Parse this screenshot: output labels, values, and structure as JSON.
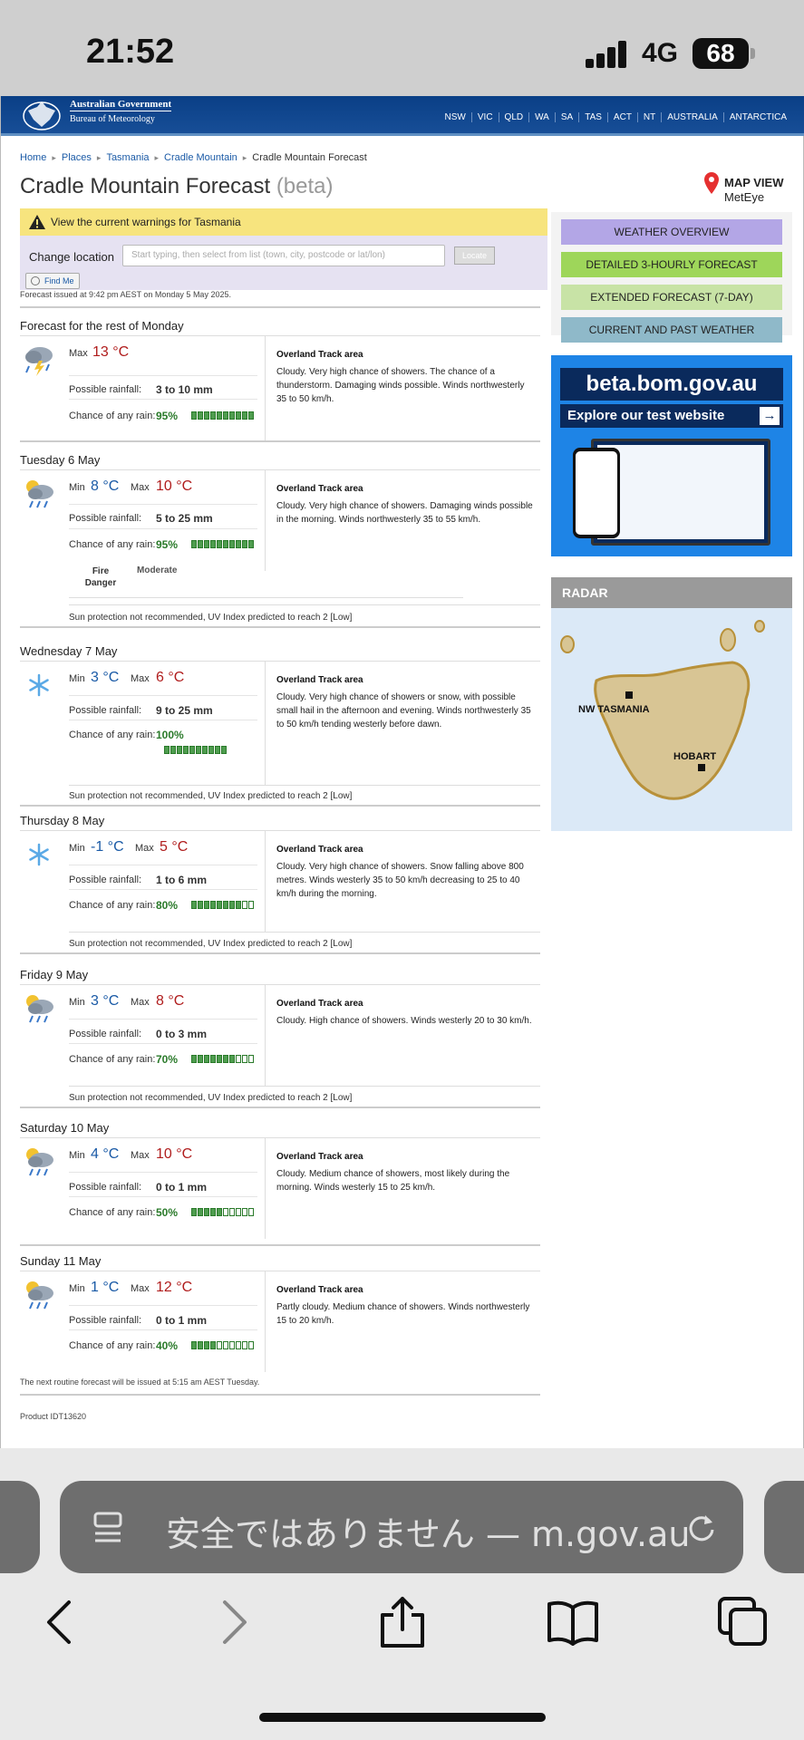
{
  "status_bar": {
    "time": "21:52",
    "network": "4G",
    "battery": "68"
  },
  "header": {
    "gov_line1": "Australian Government",
    "gov_line2": "Bureau of Meteorology",
    "nav": [
      "NSW",
      "VIC",
      "QLD",
      "WA",
      "SA",
      "TAS",
      "ACT",
      "NT",
      "AUSTRALIA",
      "ANTARCTICA"
    ]
  },
  "breadcrumbs": [
    "Home",
    "Places",
    "Tasmania",
    "Cradle Mountain",
    "Cradle Mountain Forecast"
  ],
  "page_title": {
    "main": "Cradle Mountain Forecast",
    "suffix": "(beta)"
  },
  "map_view": {
    "line1": "MAP VIEW",
    "line2": "MetEye"
  },
  "warning": {
    "text": "View the current warnings for Tasmania"
  },
  "location": {
    "label": "Change location",
    "placeholder": "Start typing, then select from list (town, city, postcode or lat/lon)",
    "locate_button": "Locate",
    "find_me": "Find Me"
  },
  "issued": "Forecast issued at 9:42 pm AEST on Monday 5 May 2025.",
  "labels": {
    "min": "Min",
    "max": "Max",
    "possible_rainfall": "Possible rainfall:",
    "chance_rain": "Chance of any rain:",
    "area": "Overland Track area"
  },
  "days": [
    {
      "name": "Forecast for the rest of Monday",
      "icon": "storm-icon",
      "max": "13 °C",
      "rainfall": "3 to 10 mm",
      "chance": "95%",
      "chance_fraction": 0.95,
      "desc": "Cloudy. Very high chance of showers. The chance of a thunderstorm. Damaging winds possible. Winds northwesterly 35 to 50 km/h."
    },
    {
      "name": "Tuesday 6 May",
      "icon": "showers-icon",
      "min": "8 °C",
      "max": "10 °C",
      "rainfall": "5 to 25 mm",
      "chance": "95%",
      "chance_fraction": 0.95,
      "desc": "Cloudy. Very high chance of showers. Damaging winds possible in the morning. Winds northwesterly 35 to 55 km/h.",
      "fire_label": "Fire Danger",
      "fire_value": "Moderate",
      "uv": "Sun protection not recommended, UV Index predicted to reach 2 [Low]"
    },
    {
      "name": "Wednesday 7 May",
      "icon": "snow-icon",
      "min": "3 °C",
      "max": "6 °C",
      "rainfall": "9 to 25 mm",
      "chance": "100%",
      "chance_fraction": 1.0,
      "desc": "Cloudy. Very high chance of showers or snow, with possible small hail in the afternoon and evening. Winds northwesterly 35 to 50 km/h tending westerly before dawn.",
      "uv": "Sun protection not recommended, UV Index predicted to reach 2 [Low]"
    },
    {
      "name": "Thursday 8 May",
      "icon": "snow-icon",
      "min": "-1 °C",
      "max": "5 °C",
      "rainfall": "1 to 6 mm",
      "chance": "80%",
      "chance_fraction": 0.8,
      "desc": "Cloudy. Very high chance of showers. Snow falling above 800 metres. Winds westerly 35 to 50 km/h decreasing to 25 to 40 km/h during the morning.",
      "uv": "Sun protection not recommended, UV Index predicted to reach 2 [Low]"
    },
    {
      "name": "Friday 9 May",
      "icon": "showers-icon",
      "min": "3 °C",
      "max": "8 °C",
      "rainfall": "0 to 3 mm",
      "chance": "70%",
      "chance_fraction": 0.7,
      "desc": "Cloudy. High chance of showers. Winds westerly 20 to 30 km/h.",
      "uv": "Sun protection not recommended, UV Index predicted to reach 2 [Low]"
    },
    {
      "name": "Saturday 10 May",
      "icon": "showers-icon",
      "min": "4 °C",
      "max": "10 °C",
      "rainfall": "0 to 1 mm",
      "chance": "50%",
      "chance_fraction": 0.5,
      "desc": "Cloudy. Medium chance of showers, most likely during the morning. Winds westerly 15 to 25 km/h."
    },
    {
      "name": "Sunday 11 May",
      "icon": "showers-icon",
      "min": "1 °C",
      "max": "12 °C",
      "rainfall": "0 to 1 mm",
      "chance": "40%",
      "chance_fraction": 0.4,
      "desc": "Partly cloudy. Medium chance of showers. Winds northwesterly 15 to 20 km/h."
    }
  ],
  "next_issue": "The next routine forecast will be issued at 5:15 am AEST Tuesday.",
  "product": "Product IDT13620",
  "side_nav": [
    {
      "label": "WEATHER OVERVIEW",
      "color": "#b3a6e6"
    },
    {
      "label": "DETAILED 3-HOURLY FORECAST",
      "color": "#9ed65a"
    },
    {
      "label": "EXTENDED FORECAST (7-DAY)",
      "color": "#c8e3a6"
    },
    {
      "label": "CURRENT AND PAST WEATHER",
      "color": "#8fb9c9"
    }
  ],
  "promo": {
    "line1": "beta.bom.gov.au",
    "line2": "Explore our test website"
  },
  "radar": {
    "title": "RADAR",
    "label1": "NW TASMANIA",
    "label2": "HOBART"
  },
  "browser": {
    "url_text": "安全ではありません — m.gov.au"
  }
}
